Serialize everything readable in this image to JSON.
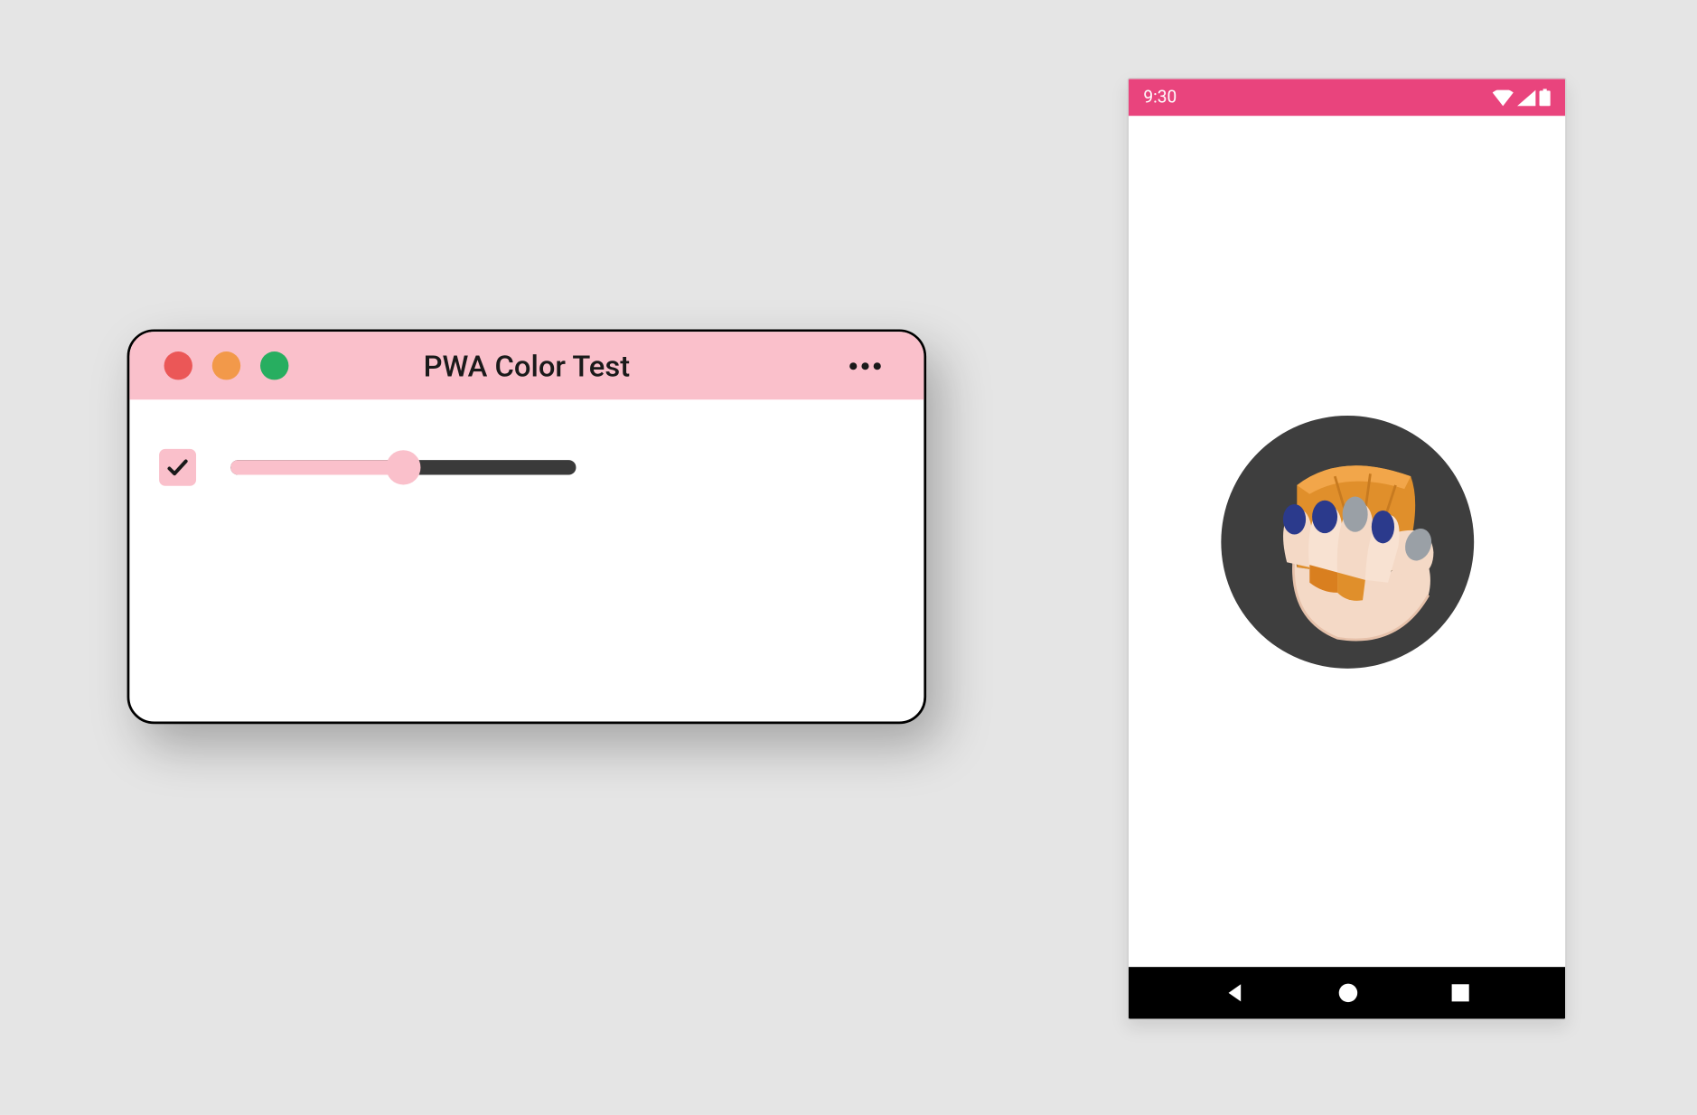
{
  "colors": {
    "background": "#e5e5e5",
    "theme_pink": "#fac0cb",
    "brand_pink": "#e9447d",
    "dark_grey": "#3a3a3a",
    "app_circle": "#3e3e3e",
    "traffic_close": "#eb5757",
    "traffic_min": "#f2994a",
    "traffic_max": "#27ae60"
  },
  "desktop_window": {
    "title": "PWA Color Test",
    "more_icon": "more-horizontal-icon",
    "traffic_lights": [
      "close",
      "minimize",
      "maximize"
    ],
    "controls": {
      "checkbox_checked": true,
      "slider_value_percent": 50
    }
  },
  "phone": {
    "status_bar": {
      "time": "9:30",
      "icons": [
        "wifi-icon",
        "signal-icon",
        "battery-icon"
      ]
    },
    "splash": {
      "app_icon_name": "squoosh-hand-icon"
    },
    "nav_bar": {
      "buttons": [
        "back-button",
        "home-button",
        "recents-button"
      ]
    }
  }
}
